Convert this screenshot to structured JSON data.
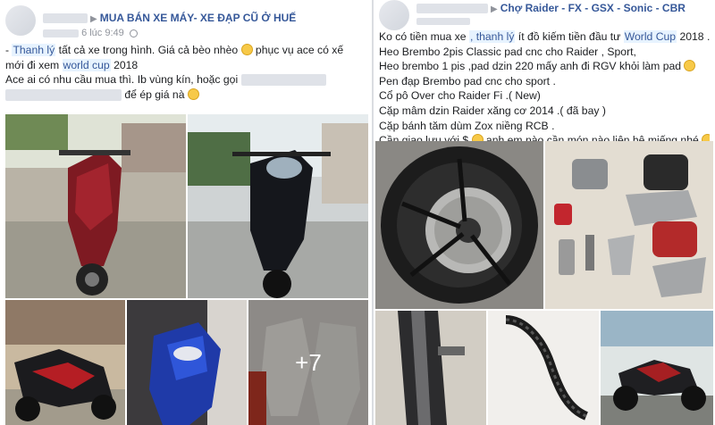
{
  "left_post": {
    "group_name": "MUA BÁN XE MÁY- XE ĐẠP CŨ Ở HUẾ",
    "timestamp": "6 lúc 9:49",
    "lines": [
      {
        "pre": "- ",
        "tag": "Thanh lý",
        "post": " tất cả xe trong hình. Giá cả bèo nhèo "
      },
      {
        "pre": "mới đi xem ",
        "tag": "world cup",
        "post": " 2018"
      },
      {
        "pre": "Ace ai có nhu cầu mua thì. Ib vùng kín, hoặc gọi ",
        "tag": "",
        "post": ""
      },
      {
        "pre": "",
        "tag": "",
        "post": "để ép giá nà"
      }
    ],
    "line1_tail": " phục vụ ace có xế",
    "more_photos_label": "+7"
  },
  "right_post": {
    "group_name": "Chợ Raider - FX - GSX - Sonic - CBR",
    "lines": [
      {
        "pre": "Ko có tiền mua xe ",
        "tag": ", thanh lý",
        "post": " ít đồ kiếm tiền đầu tư "
      },
      {
        "pre": "Heo Brembo 2pis Classic pad cnc cho Raider , Sport,",
        "tag": "",
        "post": ""
      },
      {
        "pre": "Heo brembo 1 pis ,pad dzin 220 mấy anh đi RGV khỏi làm pad ",
        "tag": "",
        "post": ""
      },
      {
        "pre": "Pen đạp Brembo pad cnc cho sport .",
        "tag": "",
        "post": ""
      },
      {
        "pre": "Cổ pô Over cho Raider Fi .( New)",
        "tag": "",
        "post": ""
      },
      {
        "pre": "Cặp mâm dzin Raider xăng cơ 2014 .( đã bay )",
        "tag": "",
        "post": ""
      },
      {
        "pre": "Cặp bánh tăm dùm Zox niềng RCB .",
        "tag": "",
        "post": ""
      },
      {
        "pre": "Cần giao lưu với $ ",
        "tag": "",
        "post": " anh em nào cần món nào liên hệ miếng nhé "
      }
    ],
    "line1_tag2": "World Cup",
    "line1_end": " 2018 ."
  }
}
